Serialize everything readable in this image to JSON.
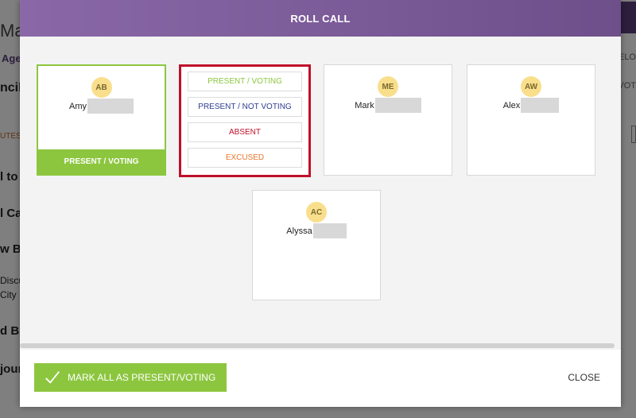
{
  "background": {
    "title": "Ma",
    "agenda_label": "Age",
    "council_label": "ncil",
    "minutes_label": "UTES",
    "item_call_to": "l to",
    "item_call": "l Ca",
    "item_new": "w B",
    "item_disc": "Discu",
    "item_city": "City L",
    "item_old": "d Bu",
    "item_adj": "jour",
    "right_vel": "VELO",
    "right_vot": "VOT"
  },
  "modal": {
    "title": "ROLL CALL",
    "members": [
      {
        "initials": "AB",
        "name": "Amy",
        "status": "PRESENT / VOTING"
      },
      {
        "initials": "ME",
        "name": "Mark"
      },
      {
        "initials": "AW",
        "name": "Alex"
      },
      {
        "initials": "AC",
        "name": "Alyssa"
      }
    ],
    "options": {
      "present_voting": "PRESENT / VOTING",
      "present_not_voting": "PRESENT / NOT VOTING",
      "absent": "ABSENT",
      "excused": "EXCUSED"
    },
    "footer": {
      "mark_all_label": "MARK ALL AS PRESENT/VOTING",
      "close_label": "CLOSE"
    }
  },
  "colors": {
    "header_purple": "#7b5b98",
    "present_green": "#8cc63f",
    "not_voting_blue": "#2e3d8f",
    "absent_red": "#c0102a",
    "excused_orange": "#e8762b",
    "avatar_yellow": "#f9df8c"
  },
  "icons": {
    "check": "check-icon"
  }
}
